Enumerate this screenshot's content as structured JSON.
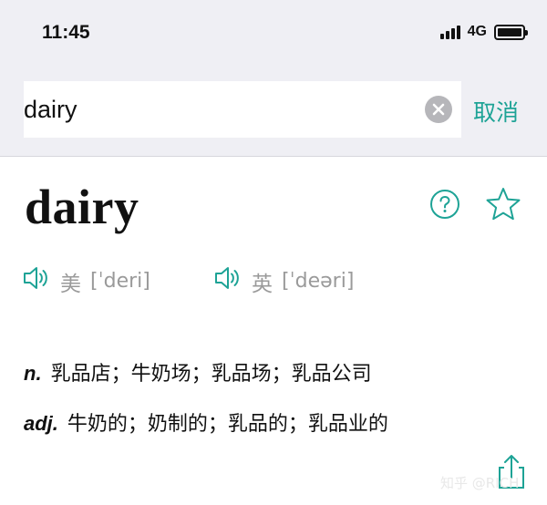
{
  "status_bar": {
    "time": "11:45",
    "network": "4G"
  },
  "search": {
    "value": "dairy",
    "placeholder": "",
    "cancel_label": "取消"
  },
  "entry": {
    "word": "dairy",
    "pronunciations": [
      {
        "region": "美",
        "phonetic": "[ˈderi]"
      },
      {
        "region": "英",
        "phonetic": "[ˈdeəri]"
      }
    ],
    "definitions": [
      {
        "pos": "n.",
        "meaning": "乳品店；牛奶场；乳品场；乳品公司"
      },
      {
        "pos": "adj.",
        "meaning": "牛奶的；奶制的；乳品的；乳品业的"
      }
    ]
  },
  "watermark": "知乎 @RICH",
  "colors": {
    "accent": "#1ea396",
    "top_background": "#efeff4",
    "muted_text": "#9a9a9a"
  },
  "icons": {
    "help": "question-circle-icon",
    "favorite": "star-outline-icon",
    "audio": "speaker-icon",
    "share": "share-icon",
    "clear": "clear-circle-icon"
  }
}
